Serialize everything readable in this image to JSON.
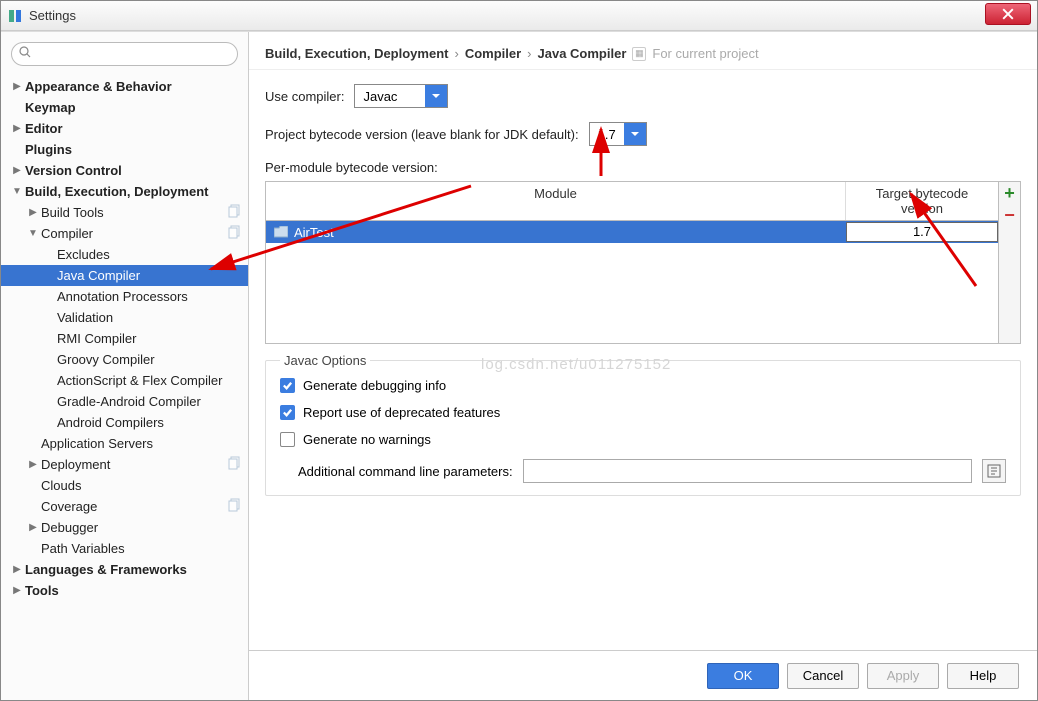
{
  "window": {
    "title": "Settings"
  },
  "breadcrumb": {
    "a": "Build, Execution, Deployment",
    "b": "Compiler",
    "c": "Java Compiler",
    "scope": "For current project"
  },
  "sidebar": {
    "items": [
      {
        "label": "Appearance & Behavior",
        "indent": 0,
        "arrow": "▶",
        "bold": true
      },
      {
        "label": "Keymap",
        "indent": 0,
        "arrow": "",
        "bold": true
      },
      {
        "label": "Editor",
        "indent": 0,
        "arrow": "▶",
        "bold": true
      },
      {
        "label": "Plugins",
        "indent": 0,
        "arrow": "",
        "bold": true
      },
      {
        "label": "Version Control",
        "indent": 0,
        "arrow": "▶",
        "bold": true
      },
      {
        "label": "Build, Execution, Deployment",
        "indent": 0,
        "arrow": "▼",
        "bold": true
      },
      {
        "label": "Build Tools",
        "indent": 1,
        "arrow": "▶",
        "copy": true
      },
      {
        "label": "Compiler",
        "indent": 1,
        "arrow": "▼",
        "copy": true
      },
      {
        "label": "Excludes",
        "indent": 2,
        "arrow": ""
      },
      {
        "label": "Java Compiler",
        "indent": 2,
        "arrow": "",
        "selected": true
      },
      {
        "label": "Annotation Processors",
        "indent": 2,
        "arrow": ""
      },
      {
        "label": "Validation",
        "indent": 2,
        "arrow": ""
      },
      {
        "label": "RMI Compiler",
        "indent": 2,
        "arrow": ""
      },
      {
        "label": "Groovy Compiler",
        "indent": 2,
        "arrow": ""
      },
      {
        "label": "ActionScript & Flex Compiler",
        "indent": 2,
        "arrow": ""
      },
      {
        "label": "Gradle-Android Compiler",
        "indent": 2,
        "arrow": ""
      },
      {
        "label": "Android Compilers",
        "indent": 2,
        "arrow": ""
      },
      {
        "label": "Application Servers",
        "indent": 1,
        "arrow": ""
      },
      {
        "label": "Deployment",
        "indent": 1,
        "arrow": "▶",
        "copy": true
      },
      {
        "label": "Clouds",
        "indent": 1,
        "arrow": ""
      },
      {
        "label": "Coverage",
        "indent": 1,
        "arrow": "",
        "copy": true
      },
      {
        "label": "Debugger",
        "indent": 1,
        "arrow": "▶"
      },
      {
        "label": "Path Variables",
        "indent": 1,
        "arrow": ""
      },
      {
        "label": "Languages & Frameworks",
        "indent": 0,
        "arrow": "▶",
        "bold": true
      },
      {
        "label": "Tools",
        "indent": 0,
        "arrow": "▶",
        "bold": true
      }
    ]
  },
  "form": {
    "useCompilerLabel": "Use compiler:",
    "useCompilerValue": "Javac",
    "bytecodeLabel": "Project bytecode version (leave blank for JDK default):",
    "bytecodeValue": "1.7",
    "perModuleLabel": "Per-module bytecode version:",
    "table": {
      "colModule": "Module",
      "colTarget": "Target bytecode version",
      "rows": [
        {
          "module": "AirTest",
          "target": "1.7"
        }
      ]
    },
    "javacOptions": {
      "legend": "Javac Options",
      "cb1": "Generate debugging info",
      "cb2": "Report use of deprecated features",
      "cb3": "Generate no warnings",
      "paramLabel": "Additional command line parameters:",
      "paramValue": ""
    }
  },
  "buttons": {
    "ok": "OK",
    "cancel": "Cancel",
    "apply": "Apply",
    "help": "Help"
  },
  "watermark": "log.csdn.net/u011275152"
}
